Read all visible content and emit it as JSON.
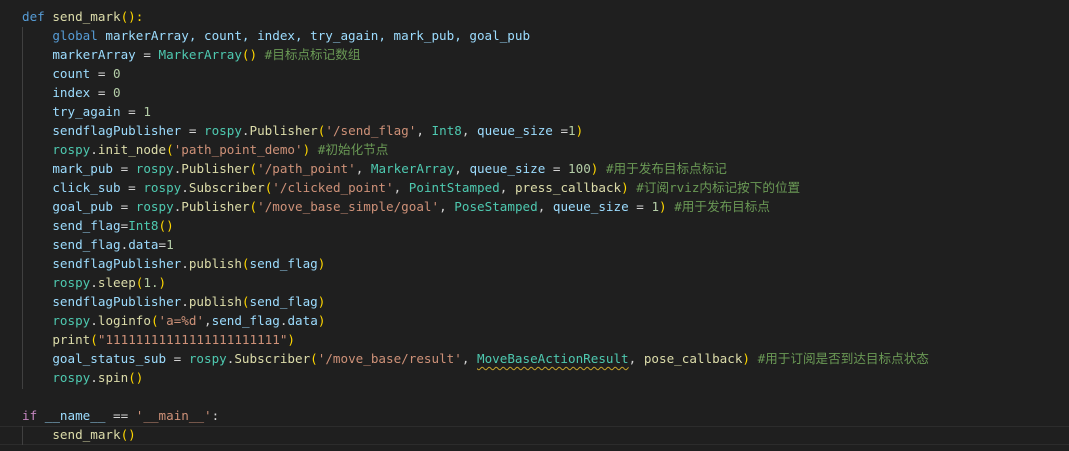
{
  "editor": {
    "background": "#1f1f1f",
    "current_line_index": 22,
    "squiggle_color": "#c8a52e",
    "colors": {
      "keyword": "#c586c0",
      "def": "#569cd6",
      "function": "#dcdcaa",
      "variable": "#9cdcfe",
      "number": "#b5cea8",
      "string": "#ce9178",
      "comment": "#6a9955",
      "class": "#4ec9b0",
      "bracket": "#ffd700",
      "default": "#d4d4d4"
    },
    "lines": [
      [
        [
          "def",
          "def"
        ],
        [
          " ",
          "default"
        ],
        [
          "send_mark",
          "function"
        ],
        [
          "():",
          "bracket"
        ]
      ],
      [
        [
          "    ",
          "default"
        ],
        [
          "global",
          "def"
        ],
        [
          " markerArray, count, index, try_again, mark_pub, goal_pub",
          "variable"
        ]
      ],
      [
        [
          "    ",
          "default"
        ],
        [
          "markerArray",
          "variable"
        ],
        [
          " = ",
          "default"
        ],
        [
          "MarkerArray",
          "class"
        ],
        [
          "()",
          "bracket"
        ],
        [
          " ",
          "default"
        ],
        [
          "#目标点标记数组",
          "comment"
        ]
      ],
      [
        [
          "    ",
          "default"
        ],
        [
          "count",
          "variable"
        ],
        [
          " = ",
          "default"
        ],
        [
          "0",
          "number"
        ]
      ],
      [
        [
          "    ",
          "default"
        ],
        [
          "index",
          "variable"
        ],
        [
          " = ",
          "default"
        ],
        [
          "0",
          "number"
        ]
      ],
      [
        [
          "    ",
          "default"
        ],
        [
          "try_again",
          "variable"
        ],
        [
          " = ",
          "default"
        ],
        [
          "1",
          "number"
        ]
      ],
      [
        [
          "    ",
          "default"
        ],
        [
          "sendflagPublisher",
          "variable"
        ],
        [
          " = ",
          "default"
        ],
        [
          "rospy",
          "class"
        ],
        [
          ".",
          "default"
        ],
        [
          "Publisher",
          "function"
        ],
        [
          "(",
          "bracket"
        ],
        [
          "'/send_flag'",
          "string"
        ],
        [
          ", ",
          "default"
        ],
        [
          "Int8",
          "class"
        ],
        [
          ", ",
          "default"
        ],
        [
          "queue_size",
          "variable"
        ],
        [
          " =",
          "default"
        ],
        [
          "1",
          "number"
        ],
        [
          ")",
          "bracket"
        ]
      ],
      [
        [
          "    ",
          "default"
        ],
        [
          "rospy",
          "class"
        ],
        [
          ".",
          "default"
        ],
        [
          "init_node",
          "function"
        ],
        [
          "(",
          "bracket"
        ],
        [
          "'path_point_demo'",
          "string"
        ],
        [
          ")",
          "bracket"
        ],
        [
          " ",
          "default"
        ],
        [
          "#初始化节点",
          "comment"
        ]
      ],
      [
        [
          "    ",
          "default"
        ],
        [
          "mark_pub",
          "variable"
        ],
        [
          " = ",
          "default"
        ],
        [
          "rospy",
          "class"
        ],
        [
          ".",
          "default"
        ],
        [
          "Publisher",
          "function"
        ],
        [
          "(",
          "bracket"
        ],
        [
          "'/path_point'",
          "string"
        ],
        [
          ", ",
          "default"
        ],
        [
          "MarkerArray",
          "class"
        ],
        [
          ", ",
          "default"
        ],
        [
          "queue_size",
          "variable"
        ],
        [
          " = ",
          "default"
        ],
        [
          "100",
          "number"
        ],
        [
          ")",
          "bracket"
        ],
        [
          " ",
          "default"
        ],
        [
          "#用于发布目标点标记",
          "comment"
        ]
      ],
      [
        [
          "    ",
          "default"
        ],
        [
          "click_sub",
          "variable"
        ],
        [
          " = ",
          "default"
        ],
        [
          "rospy",
          "class"
        ],
        [
          ".",
          "default"
        ],
        [
          "Subscriber",
          "function"
        ],
        [
          "(",
          "bracket"
        ],
        [
          "'/clicked_point'",
          "string"
        ],
        [
          ", ",
          "default"
        ],
        [
          "PointStamped",
          "class"
        ],
        [
          ", ",
          "default"
        ],
        [
          "press_callback",
          "function"
        ],
        [
          ")",
          "bracket"
        ],
        [
          " ",
          "default"
        ],
        [
          "#订阅rviz内标记按下的位置",
          "comment"
        ]
      ],
      [
        [
          "    ",
          "default"
        ],
        [
          "goal_pub",
          "variable"
        ],
        [
          " = ",
          "default"
        ],
        [
          "rospy",
          "class"
        ],
        [
          ".",
          "default"
        ],
        [
          "Publisher",
          "function"
        ],
        [
          "(",
          "bracket"
        ],
        [
          "'/move_base_simple/goal'",
          "string"
        ],
        [
          ", ",
          "default"
        ],
        [
          "PoseStamped",
          "class"
        ],
        [
          ", ",
          "default"
        ],
        [
          "queue_size",
          "variable"
        ],
        [
          " = ",
          "default"
        ],
        [
          "1",
          "number"
        ],
        [
          ")",
          "bracket"
        ],
        [
          " ",
          "default"
        ],
        [
          "#用于发布目标点",
          "comment"
        ]
      ],
      [
        [
          "    ",
          "default"
        ],
        [
          "send_flag",
          "variable"
        ],
        [
          "=",
          "default"
        ],
        [
          "Int8",
          "class"
        ],
        [
          "()",
          "bracket"
        ]
      ],
      [
        [
          "    ",
          "default"
        ],
        [
          "send_flag",
          "variable"
        ],
        [
          ".",
          "default"
        ],
        [
          "data",
          "variable"
        ],
        [
          "=",
          "default"
        ],
        [
          "1",
          "number"
        ]
      ],
      [
        [
          "    ",
          "default"
        ],
        [
          "sendflagPublisher",
          "variable"
        ],
        [
          ".",
          "default"
        ],
        [
          "publish",
          "function"
        ],
        [
          "(",
          "bracket"
        ],
        [
          "send_flag",
          "variable"
        ],
        [
          ")",
          "bracket"
        ]
      ],
      [
        [
          "    ",
          "default"
        ],
        [
          "rospy",
          "class"
        ],
        [
          ".",
          "default"
        ],
        [
          "sleep",
          "function"
        ],
        [
          "(",
          "bracket"
        ],
        [
          "1.",
          "number"
        ],
        [
          ")",
          "bracket"
        ]
      ],
      [
        [
          "    ",
          "default"
        ],
        [
          "sendflagPublisher",
          "variable"
        ],
        [
          ".",
          "default"
        ],
        [
          "publish",
          "function"
        ],
        [
          "(",
          "bracket"
        ],
        [
          "send_flag",
          "variable"
        ],
        [
          ")",
          "bracket"
        ]
      ],
      [
        [
          "    ",
          "default"
        ],
        [
          "rospy",
          "class"
        ],
        [
          ".",
          "default"
        ],
        [
          "loginfo",
          "function"
        ],
        [
          "(",
          "bracket"
        ],
        [
          "'a=%d'",
          "string"
        ],
        [
          ",",
          "default"
        ],
        [
          "send_flag",
          "variable"
        ],
        [
          ".",
          "default"
        ],
        [
          "data",
          "variable"
        ],
        [
          ")",
          "bracket"
        ]
      ],
      [
        [
          "    ",
          "default"
        ],
        [
          "print",
          "function"
        ],
        [
          "(",
          "bracket"
        ],
        [
          "\"11111111111111111111111\"",
          "string"
        ],
        [
          ")",
          "bracket"
        ]
      ],
      [
        [
          "    ",
          "default"
        ],
        [
          "goal_status_sub",
          "variable"
        ],
        [
          " = ",
          "default"
        ],
        [
          "rospy",
          "class"
        ],
        [
          ".",
          "default"
        ],
        [
          "Subscriber",
          "function"
        ],
        [
          "(",
          "bracket"
        ],
        [
          "'/move_base/result'",
          "string"
        ],
        [
          ", ",
          "default"
        ],
        [
          "MoveBaseActionResult",
          "class",
          true
        ],
        [
          ", ",
          "default"
        ],
        [
          "pose_callback",
          "function"
        ],
        [
          ")",
          "bracket"
        ],
        [
          " ",
          "default"
        ],
        [
          "#用于订阅是否到达目标点状态",
          "comment"
        ]
      ],
      [
        [
          "    ",
          "default"
        ],
        [
          "rospy",
          "class"
        ],
        [
          ".",
          "default"
        ],
        [
          "spin",
          "function"
        ],
        [
          "()",
          "bracket"
        ]
      ],
      [
        [
          "",
          "default"
        ]
      ],
      [
        [
          "if",
          "keyword"
        ],
        [
          " ",
          "default"
        ],
        [
          "__name__",
          "variable"
        ],
        [
          " == ",
          "default"
        ],
        [
          "'__main__'",
          "string"
        ],
        [
          ":",
          "default"
        ]
      ],
      [
        [
          "    ",
          "default"
        ],
        [
          "send_mark",
          "function"
        ],
        [
          "()",
          "bracket"
        ]
      ]
    ]
  }
}
